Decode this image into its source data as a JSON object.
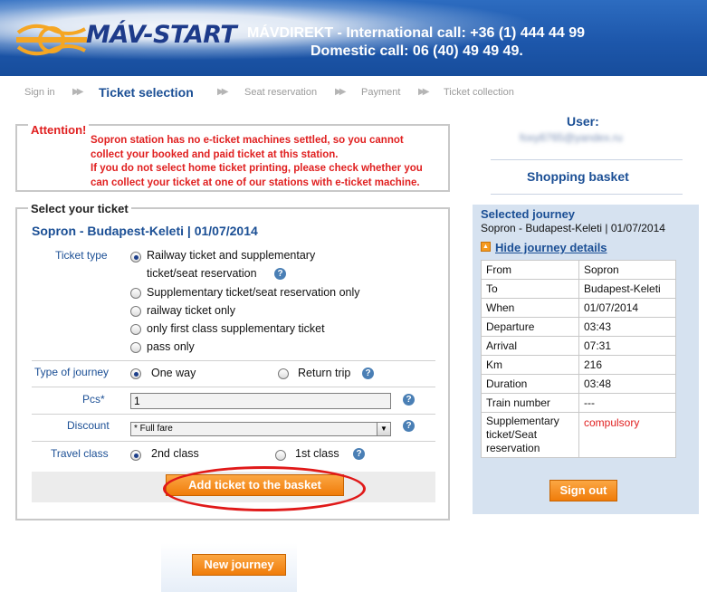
{
  "header": {
    "logo_text": "MÁV-START",
    "line1": "MÁVDIREKT - International call: +36 (1) 444 44 99",
    "line2": "Domestic call: 06 (40) 49 49 49."
  },
  "steps": [
    "Sign in",
    "Ticket selection",
    "Seat reservation",
    "Payment",
    "Ticket collection"
  ],
  "attention": {
    "title": "Attention!",
    "line1": "Sopron station has no e-ticket machines settled, so you cannot",
    "line2": "collect your booked and paid ticket at this station.",
    "line3": "If you do not select home ticket printing, please check whether you",
    "line4": "can collect your ticket at one of our stations with e-ticket machine."
  },
  "select": {
    "legend": "Select your ticket",
    "journey": "Sopron - Budapest-Keleti | 01/07/2014",
    "ticket_type_label": "Ticket type",
    "ticket_options": [
      "Railway ticket and supplementary",
      "ticket/seat reservation",
      "Supplementary ticket/seat reservation only",
      "railway ticket only",
      "only first class supplementary ticket",
      "pass only"
    ],
    "journey_type_label": "Type of journey",
    "one_way": "One way",
    "return_trip": "Return trip",
    "pcs_label": "Pcs*",
    "pcs_value": "1",
    "discount_label": "Discount",
    "discount_value": "* Full fare",
    "travel_class_label": "Travel class",
    "class2": "2nd class",
    "class1": "1st class",
    "add_button": "Add ticket to the basket",
    "new_journey_button": "New journey",
    "help_glyph": "?"
  },
  "sidebar": {
    "user_label": "User:",
    "user_email": "foxy8765@yandex.ru",
    "basket_label": "Shopping basket",
    "selected_journey_label": "Selected journey",
    "selected_route": "Sopron - Budapest-Keleti | 01/07/2014",
    "hide_link": "Hide journey details",
    "details": [
      {
        "k": "From",
        "v": "Sopron"
      },
      {
        "k": "To",
        "v": "Budapest-Keleti"
      },
      {
        "k": "When",
        "v": "01/07/2014"
      },
      {
        "k": "Departure",
        "v": "03:43"
      },
      {
        "k": "Arrival",
        "v": "07:31"
      },
      {
        "k": "Km",
        "v": "216"
      },
      {
        "k": "Duration",
        "v": "03:48"
      },
      {
        "k": "Train number",
        "v": "---"
      },
      {
        "k": "Supplementary ticket/Seat reservation",
        "v": "compulsory"
      }
    ],
    "signout_button": "Sign out"
  },
  "colors": {
    "brand_blue": "#1b4f95",
    "alert_red": "#e02020",
    "button_orange": "#f28a1e",
    "sidebar_bg": "#d6e2f0"
  }
}
